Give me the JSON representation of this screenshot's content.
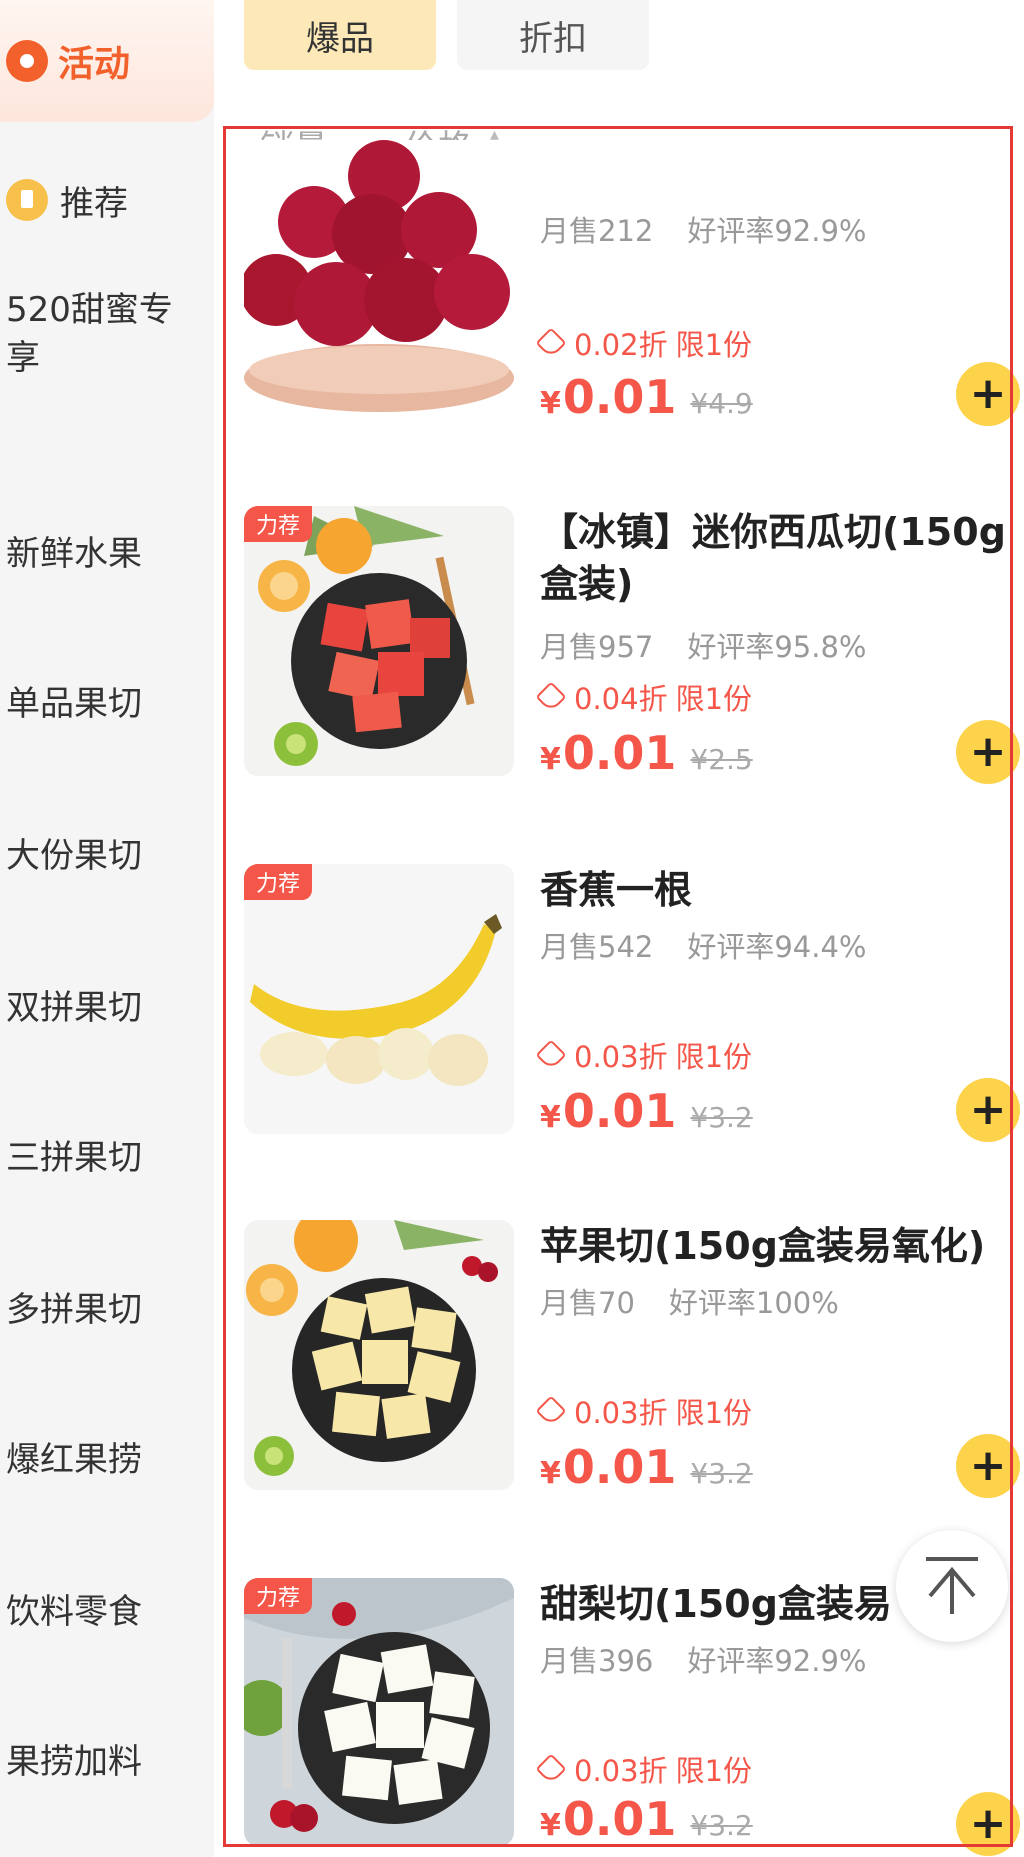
{
  "sidebar": {
    "active_label": "活动",
    "recommend_label": "推荐",
    "items": [
      {
        "label": "520甜蜜专享"
      },
      {
        "label": "新鲜水果"
      },
      {
        "label": "单品果切"
      },
      {
        "label": "大份果切"
      },
      {
        "label": "双拼果切"
      },
      {
        "label": "三拼果切"
      },
      {
        "label": "多拼果切"
      },
      {
        "label": "爆红果捞"
      },
      {
        "label": "饮料零食"
      },
      {
        "label": "果捞加料"
      }
    ]
  },
  "tabs": [
    {
      "label": "爆品"
    },
    {
      "label": "折扣"
    }
  ],
  "sort": {
    "sales_label": "销量",
    "price_label": "价格"
  },
  "products": [
    {
      "name": "",
      "stats": {
        "monthly": "月售212",
        "rating": "好评率92.9%"
      },
      "promo": {
        "discount": "0.02折",
        "limit": "限1份"
      },
      "price": {
        "symbol": "¥",
        "value": "0.01",
        "original": "¥4.9"
      }
    },
    {
      "tag": "力荐",
      "name": "【冰镇】迷你西瓜切(150g盒装)",
      "stats": {
        "monthly": "月售957",
        "rating": "好评率95.8%"
      },
      "promo": {
        "discount": "0.04折",
        "limit": "限1份"
      },
      "price": {
        "symbol": "¥",
        "value": "0.01",
        "original": "¥2.5"
      }
    },
    {
      "tag": "力荐",
      "name": "香蕉一根",
      "stats": {
        "monthly": "月售542",
        "rating": "好评率94.4%"
      },
      "promo": {
        "discount": "0.03折",
        "limit": "限1份"
      },
      "price": {
        "symbol": "¥",
        "value": "0.01",
        "original": "¥3.2"
      }
    },
    {
      "name": "苹果切(150g盒装易氧化)",
      "stats": {
        "monthly": "月售70",
        "rating": "好评率100%"
      },
      "promo": {
        "discount": "0.03折",
        "limit": "限1份"
      },
      "price": {
        "symbol": "¥",
        "value": "0.01",
        "original": "¥3.2"
      }
    },
    {
      "tag": "力荐",
      "name": "甜梨切(150g盒装易",
      "stats": {
        "monthly": "月售396",
        "rating": "好评率92.9%"
      },
      "promo": {
        "discount": "0.03折",
        "limit": "限1份"
      },
      "price": {
        "symbol": "¥",
        "value": "0.01",
        "original": "¥3.2"
      }
    }
  ],
  "colors": {
    "accent": "#f2612b",
    "price_red": "#f4574a",
    "add_yellow": "#fcd34a",
    "highlight_frame": "#e53935"
  }
}
